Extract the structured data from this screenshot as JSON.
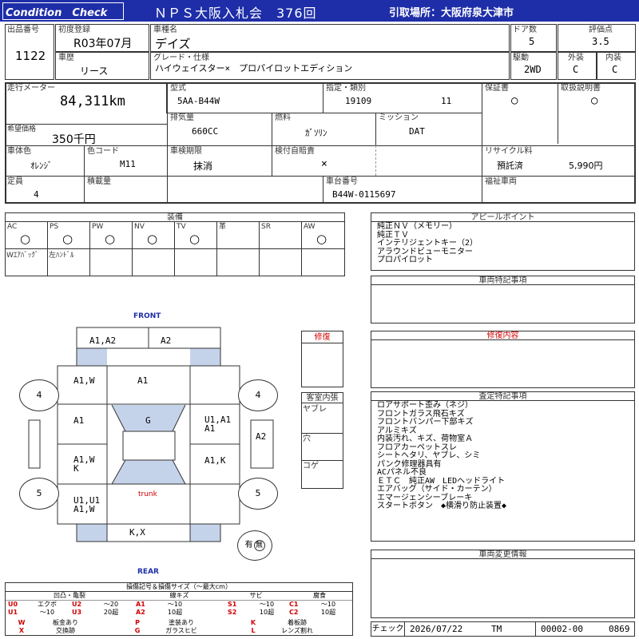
{
  "header": {
    "badge": "Condition　Check",
    "title": "ＮＰＳ大阪入札会　376回",
    "pickup": "引取場所：大阪府泉大津市"
  },
  "vehicle": {
    "lot_label": "出品番号",
    "lot": "1122",
    "first_reg_label": "初度登録",
    "first_reg": "R03年07月",
    "name_label": "車種名",
    "name": "デイズ",
    "doors_label": "ドア数",
    "doors": "5",
    "score_label": "評価点",
    "score": "3.5",
    "history_label": "車歴",
    "history": "リース",
    "grade_label": "グレード・仕様",
    "grade": "ハイウェイスター×　プロパイロットエディション",
    "drive_label": "駆動",
    "drive": "2WD",
    "exterior_label": "外装",
    "exterior": "C",
    "interior_label": "内装",
    "interior": "C",
    "odometer_label": "走行メーター",
    "odometer": "84,311km",
    "model_label": "型式",
    "model": "5AA-B44W",
    "designation_label": "指定・類別",
    "designation": "19109",
    "classification": "11",
    "warranty_label": "保証書",
    "warranty": "○",
    "manual_label": "取扱説明書",
    "manual": "○",
    "desired_price_label": "希望価格",
    "desired_price": "350千円",
    "displacement_label": "排気量",
    "displacement": "660CC",
    "fuel_label": "燃料",
    "fuel": "ｶﾞｿﾘﾝ",
    "transmission_label": "ミッション",
    "transmission": "DAT",
    "color_label": "車体色",
    "color": "ｵﾚﾝｼﾞ",
    "color_code_label": "色コード",
    "color_code": "M11",
    "inspection_label": "車検期限",
    "inspection": "抹消",
    "insurance_label": "検付自賠責",
    "insurance": "×",
    "recycle_label": "リサイクル料",
    "recycle_status": "預託済",
    "recycle_amount": "5,990円",
    "capacity_label": "定員",
    "capacity": "4",
    "load_label": "積載量",
    "load": "",
    "chassis_label": "車台番号",
    "chassis": "B44W-0115697",
    "welfare_label": "福祉車両",
    "welfare": ""
  },
  "equipment": {
    "title": "装備",
    "row1": [
      {
        "label": "AC",
        "mark": "○"
      },
      {
        "label": "PS",
        "mark": "○"
      },
      {
        "label": "PW",
        "mark": "○"
      },
      {
        "label": "NV",
        "mark": "○"
      },
      {
        "label": "TV",
        "mark": "○"
      },
      {
        "label": "革",
        "mark": ""
      },
      {
        "label": "SR",
        "mark": ""
      },
      {
        "label": "AW",
        "mark": "○"
      }
    ],
    "row2": [
      "Wｴｱﾊﾞｯｸﾞ",
      "左ﾊﾝﾄﾞﾙ",
      "",
      "",
      "",
      "",
      "",
      ""
    ]
  },
  "appeal": {
    "title": "アピールポイント",
    "items": [
      "純正ＮＶ（メモリー）",
      "純正ＴＶ",
      "インテリジェントキー（2）",
      "アラウンドビューモニター",
      "プロパイロット"
    ]
  },
  "special": {
    "title": "車両特記事項"
  },
  "repair_content": {
    "title": "修復内容"
  },
  "inspection_notes": {
    "title": "査定特記事項",
    "items": [
      "ロアサポート歪み（ネジ）",
      "フロントガラス飛石キズ",
      "フロントバンパー下部キズ",
      "アルミキズ",
      "内装汚れ、キズ、荷物室Ａ",
      "フロアカーペットスレ",
      "シートヘタリ、ヤブレ、シミ",
      "パンク修理器具有",
      "ACパネル不良",
      "ＥＴＣ　純正AW　LEDヘッドライト",
      "エアバッグ（サイド・カーテン）",
      "エマージェンシーブレーキ",
      "スタートボタン　◆横滑り防止装置◆"
    ]
  },
  "changes": {
    "title": "車両変更情報"
  },
  "diagram": {
    "front": "FRONT",
    "rear": "REAR",
    "trunk": "trunk",
    "repair_label": "修復",
    "cells": {
      "front_bumper_left": "A1,A2",
      "front_bumper_right": "A2",
      "front_fender_left": "A1,W",
      "hood": "A1",
      "front_door_left": "A1",
      "roof": "G",
      "front_door_right": "U1,A1\nA1",
      "mirror_right": "A2",
      "rear_door_left": "A1,W\nK",
      "rear_door_right": "A1,K",
      "rear_fender_left": "U1,U1\nA1,W",
      "rear_bumper": "K,X",
      "tire_fl": "4",
      "tire_fr": "4",
      "tire_rl": "5",
      "tire_rr": "5",
      "spare": "有",
      "spare_mark": "無"
    },
    "cabin": {
      "title": "客室内張",
      "items": [
        "ヤブレ",
        "穴",
        "コゲ"
      ]
    }
  },
  "legend": {
    "title": "損傷記号＆損傷サイズ（～最大cm）",
    "headers": [
      "凹凸・亀裂",
      "線キズ",
      "サビ",
      "腐食"
    ],
    "rows": [
      [
        {
          "c": "U0",
          "t": "エクボ"
        },
        {
          "c": "U2",
          "t": "～20"
        },
        {
          "c": "A1",
          "t": "～10"
        },
        {
          "c": "S1",
          "t": "～10"
        },
        {
          "c": "C1",
          "t": "～10"
        }
      ],
      [
        {
          "c": "U1",
          "t": "～10"
        },
        {
          "c": "U3",
          "t": "20超"
        },
        {
          "c": "A2",
          "t": "10超"
        },
        {
          "c": "S2",
          "t": "10超"
        },
        {
          "c": "C2",
          "t": "10超"
        }
      ]
    ],
    "rows2": [
      [
        {
          "c": "W",
          "t": "板金あり"
        },
        {
          "c": "P",
          "t": "塗装あり"
        },
        {
          "c": "K",
          "t": "着板跡"
        }
      ],
      [
        {
          "c": "X",
          "t": "交換跡"
        },
        {
          "c": "G",
          "t": "ガラスヒビ"
        },
        {
          "c": "L",
          "t": "レンズ割れ"
        }
      ]
    ]
  },
  "footer": {
    "check_label": "チェック",
    "date": "2026/07/22",
    "inspector": "TM",
    "code": "00002-00",
    "serial": "0869"
  }
}
